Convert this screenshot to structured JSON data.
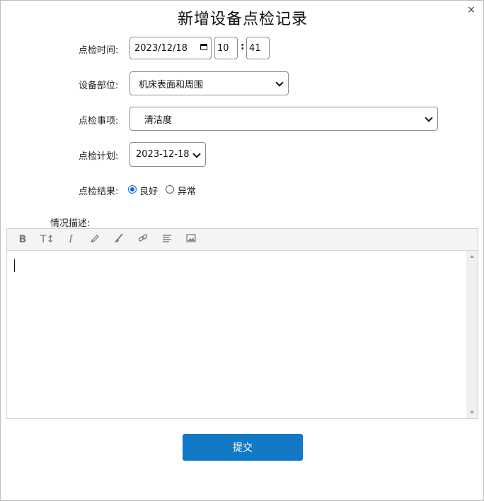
{
  "dialog": {
    "title": "新增设备点检记录",
    "close_symbol": "×"
  },
  "form": {
    "time": {
      "label": "点检时间:",
      "date_value": "2023/12/18",
      "hour_value": "10",
      "minute_value": "41",
      "separator": ":"
    },
    "part": {
      "label": "设备部位:",
      "selected": "机床表面和周围"
    },
    "item": {
      "label": "点检事项:",
      "selected": "清洁度"
    },
    "plan": {
      "label": "点检计划:",
      "selected": "2023-12-18"
    },
    "result": {
      "label": "点检结果:",
      "options": [
        {
          "label": "良好",
          "checked": true
        },
        {
          "label": "异常",
          "checked": false
        }
      ]
    },
    "description": {
      "label": "情况描述:",
      "content": ""
    }
  },
  "editor_toolbar": {
    "bold_glyph": "B",
    "font_size_glyph": "T↕",
    "italic_glyph": "I",
    "tools": [
      "bold-icon",
      "font-size-icon",
      "italic-icon",
      "highlighter-icon",
      "brush-icon",
      "link-icon",
      "align-icon",
      "image-icon"
    ]
  },
  "submit_label": "提交",
  "colors": {
    "accent": "#1279c6",
    "radio_checked": "#0b66d8"
  }
}
